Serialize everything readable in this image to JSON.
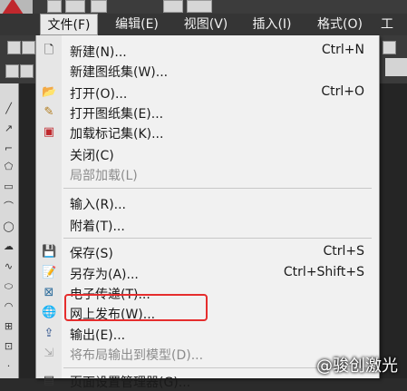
{
  "menubar": {
    "items": [
      "文件(F)",
      "编辑(E)",
      "视图(V)",
      "插入(I)",
      "格式(O)",
      "工"
    ]
  },
  "file_menu": {
    "items": [
      {
        "label": "新建(N)...",
        "shortcut": "Ctrl+N",
        "icon": "blank-document-icon",
        "disabled": false
      },
      {
        "label": "新建图纸集(W)...",
        "shortcut": "",
        "icon": "",
        "disabled": false
      },
      {
        "label": "打开(O)...",
        "shortcut": "Ctrl+O",
        "icon": "open-folder-icon",
        "disabled": false
      },
      {
        "label": "打开图纸集(E)...",
        "shortcut": "",
        "icon": "open-sheetset-icon",
        "disabled": false
      },
      {
        "label": "加载标记集(K)...",
        "shortcut": "",
        "icon": "markup-set-icon",
        "disabled": false
      },
      {
        "label": "关闭(C)",
        "shortcut": "",
        "icon": "",
        "disabled": false
      },
      {
        "label": "局部加载(L)",
        "shortcut": "",
        "icon": "",
        "disabled": true
      },
      {
        "label": "输入(R)...",
        "shortcut": "",
        "icon": "",
        "disabled": false
      },
      {
        "label": "附着(T)...",
        "shortcut": "",
        "icon": "",
        "disabled": false
      },
      {
        "label": "保存(S)",
        "shortcut": "Ctrl+S",
        "icon": "save-floppy-icon",
        "disabled": false
      },
      {
        "label": "另存为(A)...",
        "shortcut": "Ctrl+Shift+S",
        "icon": "save-as-icon",
        "disabled": false
      },
      {
        "label": "电子传递(T)...",
        "shortcut": "",
        "icon": "etransmit-icon",
        "disabled": false
      },
      {
        "label": "网上发布(W)...",
        "shortcut": "",
        "icon": "web-publish-icon",
        "disabled": false
      },
      {
        "label": "输出(E)...",
        "shortcut": "",
        "icon": "export-icon",
        "disabled": false
      },
      {
        "label": "将布局输出到模型(D)...",
        "shortcut": "",
        "icon": "layout-export-icon",
        "disabled": true
      },
      {
        "label": "页面设置管理器(G)...",
        "shortcut": "",
        "icon": "page-setup-icon",
        "disabled": false
      }
    ]
  },
  "watermark": "@骏创激光",
  "colors": {
    "highlight_box": "#e52d2d",
    "menu_bg": "#f1f1f1",
    "app_bg": "#2b2b2b"
  }
}
